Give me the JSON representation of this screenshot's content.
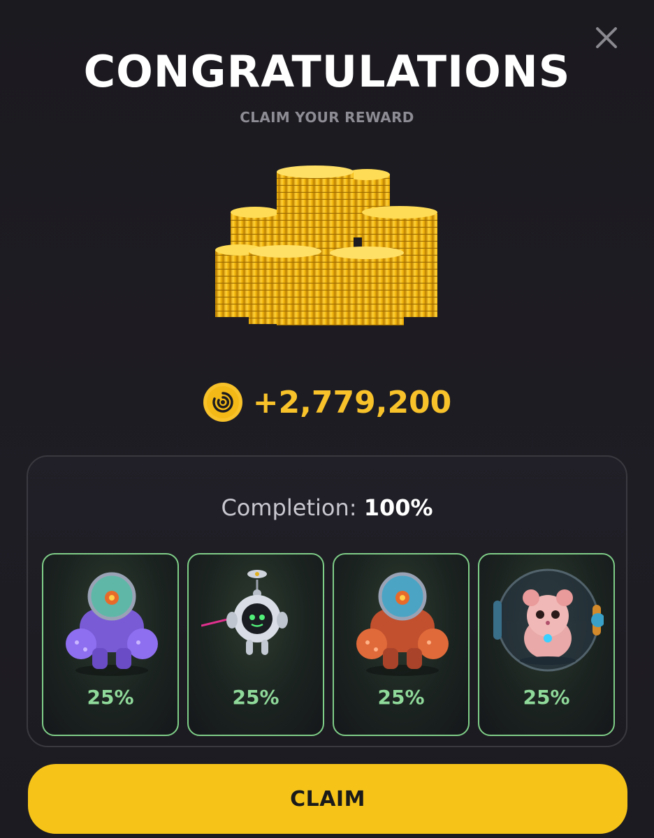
{
  "header": {
    "title": "CONGRATULATIONS",
    "subtitle": "CLAIM YOUR REWARD",
    "close_icon": "close-icon"
  },
  "reward": {
    "amount": "+2,779,200",
    "coin_icon": "hamster-coin-icon",
    "coin_color": "#f7c22a"
  },
  "completion": {
    "label": "Completion:",
    "value": "100%"
  },
  "cards": [
    {
      "icon": "purple-mech-suit-image",
      "percent": "25%"
    },
    {
      "icon": "robot-drone-image",
      "percent": "25%"
    },
    {
      "icon": "orange-mech-suit-image",
      "percent": "25%"
    },
    {
      "icon": "hamster-in-ball-image",
      "percent": "25%"
    }
  ],
  "actions": {
    "claim_label": "CLAIM",
    "accent": "#f6c419"
  }
}
